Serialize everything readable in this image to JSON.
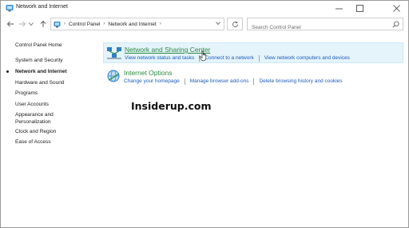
{
  "window": {
    "title": "Network and Internet"
  },
  "address": {
    "crumbs": [
      "Control Panel",
      "Network and Internet"
    ]
  },
  "search": {
    "placeholder": "Search Control Panel"
  },
  "sidebar": {
    "home": "Control Panel Home",
    "items": [
      {
        "label": "System and Security"
      },
      {
        "label": "Network and Internet"
      },
      {
        "label": "Hardware and Sound"
      },
      {
        "label": "Programs"
      },
      {
        "label": "User Accounts"
      },
      {
        "label": "Appearance and Personalization"
      },
      {
        "label": "Clock and Region"
      },
      {
        "label": "Ease of Access"
      }
    ]
  },
  "categories": [
    {
      "title": "Network and Sharing Center",
      "icon": "network-sharing-icon",
      "links": [
        "View network status and tasks",
        "Connect to a network",
        "View network computers and devices"
      ]
    },
    {
      "title": "Internet Options",
      "icon": "internet-options-icon",
      "links": [
        "Change your homepage",
        "Manage browser add-ons",
        "Delete browsing history and cookies"
      ]
    }
  ],
  "watermark": "Insiderup.com",
  "colors": {
    "category_title": "#2a8a3e",
    "link": "#1c5bb8",
    "hover_bg": "#e5f3fb"
  }
}
